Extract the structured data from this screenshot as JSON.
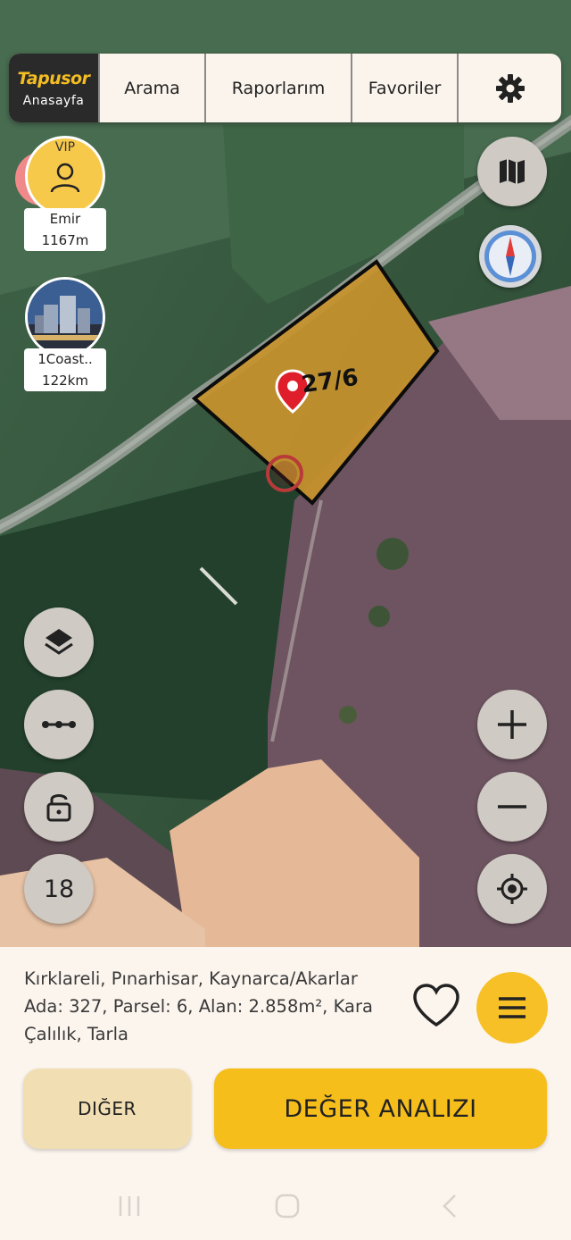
{
  "nav": {
    "logo": "Tapusor",
    "home": "Anasayfa",
    "search": "Arama",
    "reports": "Raporlarım",
    "favorites": "Favoriler"
  },
  "users": [
    {
      "badge": "VIP",
      "name": "Emir",
      "distance": "1167m"
    },
    {
      "name": "1Coast..",
      "distance": "122km"
    }
  ],
  "map": {
    "parcel_label": "27/6",
    "zoom_level": "18"
  },
  "parcel": {
    "address_line": "Kırklareli, Pınarhisar, Kaynarca/Akarlar",
    "details": "Ada: 327, Parsel: 6, Alan: 2.858m², Kara Çalılık, Tarla"
  },
  "actions": {
    "other": "DIĞER",
    "value_analysis": "DEĞER ANALIZI"
  },
  "colors": {
    "accent": "#f6be1b",
    "parcel_fill": "#c8922b",
    "nav_home_bg": "#2a2a2a"
  }
}
